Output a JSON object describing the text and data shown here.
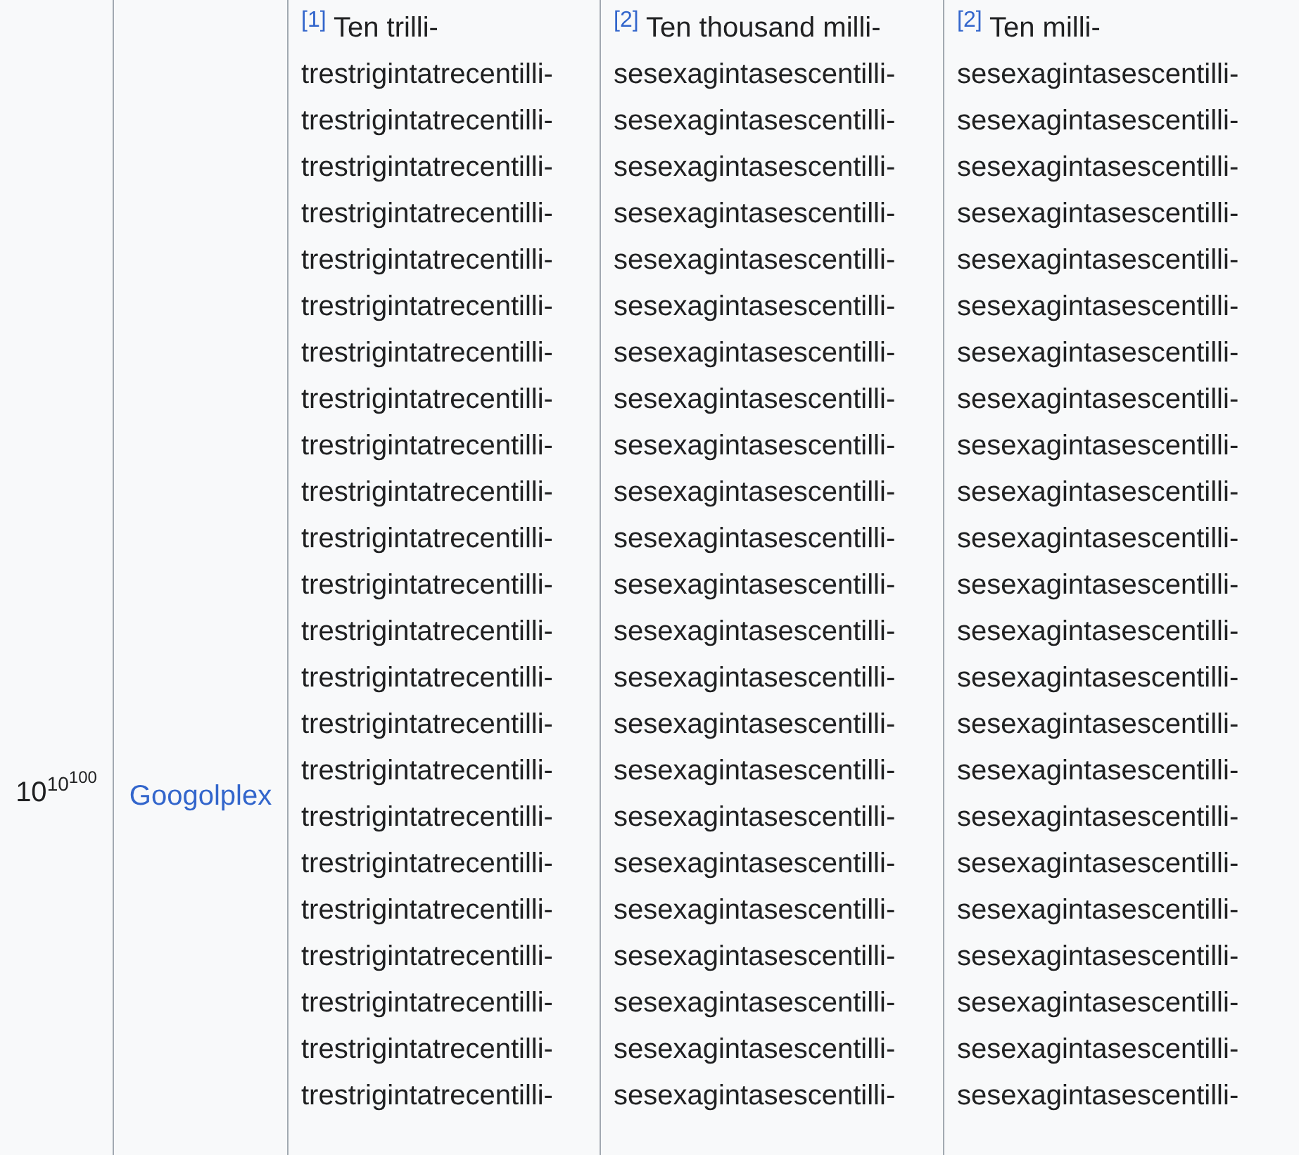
{
  "row": {
    "value": {
      "base": "10",
      "exponent": "10",
      "exponent_of_exponent": "100"
    },
    "name": {
      "text": "Googolplex"
    },
    "names": [
      {
        "ref": "[1]",
        "lines": [
          "Ten trilli-",
          "trestrigintatrecentilli-",
          "trestrigintatrecentilli-",
          "trestrigintatrecentilli-",
          "trestrigintatrecentilli-",
          "trestrigintatrecentilli-",
          "trestrigintatrecentilli-",
          "trestrigintatrecentilli-",
          "trestrigintatrecentilli-",
          "trestrigintatrecentilli-",
          "trestrigintatrecentilli-",
          "trestrigintatrecentilli-",
          "trestrigintatrecentilli-",
          "trestrigintatrecentilli-",
          "trestrigintatrecentilli-",
          "trestrigintatrecentilli-",
          "trestrigintatrecentilli-",
          "trestrigintatrecentilli-",
          "trestrigintatrecentilli-",
          "trestrigintatrecentilli-",
          "trestrigintatrecentilli-",
          "trestrigintatrecentilli-",
          "trestrigintatrecentilli-",
          "trestrigintatrecentilli-"
        ]
      },
      {
        "ref": "[2]",
        "lines": [
          "Ten thousand milli-",
          "sesexagintasescentilli-",
          "sesexagintasescentilli-",
          "sesexagintasescentilli-",
          "sesexagintasescentilli-",
          "sesexagintasescentilli-",
          "sesexagintasescentilli-",
          "sesexagintasescentilli-",
          "sesexagintasescentilli-",
          "sesexagintasescentilli-",
          "sesexagintasescentilli-",
          "sesexagintasescentilli-",
          "sesexagintasescentilli-",
          "sesexagintasescentilli-",
          "sesexagintasescentilli-",
          "sesexagintasescentilli-",
          "sesexagintasescentilli-",
          "sesexagintasescentilli-",
          "sesexagintasescentilli-",
          "sesexagintasescentilli-",
          "sesexagintasescentilli-",
          "sesexagintasescentilli-",
          "sesexagintasescentilli-",
          "sesexagintasescentilli-"
        ]
      },
      {
        "ref": "[2]",
        "lines": [
          "Ten milli-",
          "sesexagintasescentilli-",
          "sesexagintasescentilli-",
          "sesexagintasescentilli-",
          "sesexagintasescentilli-",
          "sesexagintasescentilli-",
          "sesexagintasescentilli-",
          "sesexagintasescentilli-",
          "sesexagintasescentilli-",
          "sesexagintasescentilli-",
          "sesexagintasescentilli-",
          "sesexagintasescentilli-",
          "sesexagintasescentilli-",
          "sesexagintasescentilli-",
          "sesexagintasescentilli-",
          "sesexagintasescentilli-",
          "sesexagintasescentilli-",
          "sesexagintasescentilli-",
          "sesexagintasescentilli-",
          "sesexagintasescentilli-",
          "sesexagintasescentilli-",
          "sesexagintasescentilli-",
          "sesexagintasescentilli-",
          "sesexagintasescentilli-"
        ]
      }
    ]
  }
}
